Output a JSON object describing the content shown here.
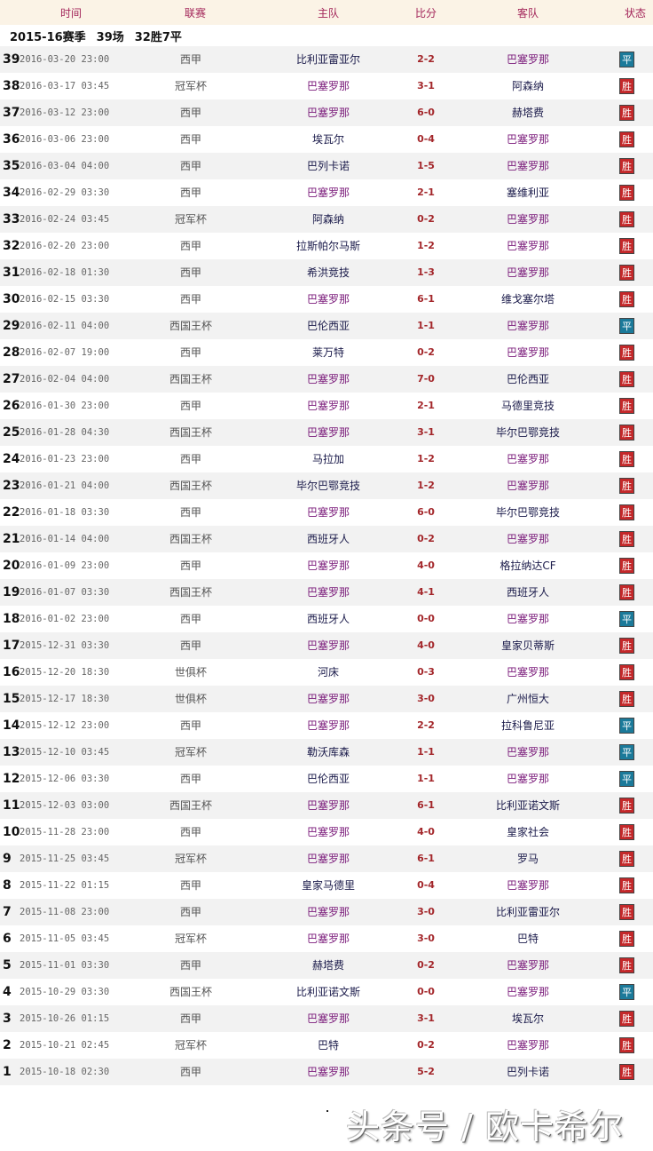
{
  "header": {
    "time": "时间",
    "league": "联赛",
    "home": "主队",
    "score": "比分",
    "away": "客队",
    "status": "状态"
  },
  "season": {
    "name": "2015-16赛季",
    "matches": "39场",
    "record": "32胜7平"
  },
  "highlight_team": "巴塞罗那",
  "status_colors": {
    "胜": "#c4282a",
    "平": "#1b7a9a"
  },
  "rows": [
    [
      "39",
      "2016-03-20 23:00",
      "西甲",
      "比利亚雷亚尔",
      "2-2",
      "巴塞罗那",
      "平"
    ],
    [
      "38",
      "2016-03-17 03:45",
      "冠军杯",
      "巴塞罗那",
      "3-1",
      "阿森纳",
      "胜"
    ],
    [
      "37",
      "2016-03-12 23:00",
      "西甲",
      "巴塞罗那",
      "6-0",
      "赫塔费",
      "胜"
    ],
    [
      "36",
      "2016-03-06 23:00",
      "西甲",
      "埃瓦尔",
      "0-4",
      "巴塞罗那",
      "胜"
    ],
    [
      "35",
      "2016-03-04 04:00",
      "西甲",
      "巴列卡诺",
      "1-5",
      "巴塞罗那",
      "胜"
    ],
    [
      "34",
      "2016-02-29 03:30",
      "西甲",
      "巴塞罗那",
      "2-1",
      "塞维利亚",
      "胜"
    ],
    [
      "33",
      "2016-02-24 03:45",
      "冠军杯",
      "阿森纳",
      "0-2",
      "巴塞罗那",
      "胜"
    ],
    [
      "32",
      "2016-02-20 23:00",
      "西甲",
      "拉斯帕尔马斯",
      "1-2",
      "巴塞罗那",
      "胜"
    ],
    [
      "31",
      "2016-02-18 01:30",
      "西甲",
      "希洪竞技",
      "1-3",
      "巴塞罗那",
      "胜"
    ],
    [
      "30",
      "2016-02-15 03:30",
      "西甲",
      "巴塞罗那",
      "6-1",
      "维戈塞尔塔",
      "胜"
    ],
    [
      "29",
      "2016-02-11 04:00",
      "西国王杯",
      "巴伦西亚",
      "1-1",
      "巴塞罗那",
      "平"
    ],
    [
      "28",
      "2016-02-07 19:00",
      "西甲",
      "莱万特",
      "0-2",
      "巴塞罗那",
      "胜"
    ],
    [
      "27",
      "2016-02-04 04:00",
      "西国王杯",
      "巴塞罗那",
      "7-0",
      "巴伦西亚",
      "胜"
    ],
    [
      "26",
      "2016-01-30 23:00",
      "西甲",
      "巴塞罗那",
      "2-1",
      "马德里竞技",
      "胜"
    ],
    [
      "25",
      "2016-01-28 04:30",
      "西国王杯",
      "巴塞罗那",
      "3-1",
      "毕尔巴鄂竞技",
      "胜"
    ],
    [
      "24",
      "2016-01-23 23:00",
      "西甲",
      "马拉加",
      "1-2",
      "巴塞罗那",
      "胜"
    ],
    [
      "23",
      "2016-01-21 04:00",
      "西国王杯",
      "毕尔巴鄂竞技",
      "1-2",
      "巴塞罗那",
      "胜"
    ],
    [
      "22",
      "2016-01-18 03:30",
      "西甲",
      "巴塞罗那",
      "6-0",
      "毕尔巴鄂竞技",
      "胜"
    ],
    [
      "21",
      "2016-01-14 04:00",
      "西国王杯",
      "西班牙人",
      "0-2",
      "巴塞罗那",
      "胜"
    ],
    [
      "20",
      "2016-01-09 23:00",
      "西甲",
      "巴塞罗那",
      "4-0",
      "格拉纳达CF",
      "胜"
    ],
    [
      "19",
      "2016-01-07 03:30",
      "西国王杯",
      "巴塞罗那",
      "4-1",
      "西班牙人",
      "胜"
    ],
    [
      "18",
      "2016-01-02 23:00",
      "西甲",
      "西班牙人",
      "0-0",
      "巴塞罗那",
      "平"
    ],
    [
      "17",
      "2015-12-31 03:30",
      "西甲",
      "巴塞罗那",
      "4-0",
      "皇家贝蒂斯",
      "胜"
    ],
    [
      "16",
      "2015-12-20 18:30",
      "世俱杯",
      "河床",
      "0-3",
      "巴塞罗那",
      "胜"
    ],
    [
      "15",
      "2015-12-17 18:30",
      "世俱杯",
      "巴塞罗那",
      "3-0",
      "广州恒大",
      "胜"
    ],
    [
      "14",
      "2015-12-12 23:00",
      "西甲",
      "巴塞罗那",
      "2-2",
      "拉科鲁尼亚",
      "平"
    ],
    [
      "13",
      "2015-12-10 03:45",
      "冠军杯",
      "勒沃库森",
      "1-1",
      "巴塞罗那",
      "平"
    ],
    [
      "12",
      "2015-12-06 03:30",
      "西甲",
      "巴伦西亚",
      "1-1",
      "巴塞罗那",
      "平"
    ],
    [
      "11",
      "2015-12-03 03:00",
      "西国王杯",
      "巴塞罗那",
      "6-1",
      "比利亚诺文斯",
      "胜"
    ],
    [
      "10",
      "2015-11-28 23:00",
      "西甲",
      "巴塞罗那",
      "4-0",
      "皇家社会",
      "胜"
    ],
    [
      "9",
      "2015-11-25 03:45",
      "冠军杯",
      "巴塞罗那",
      "6-1",
      "罗马",
      "胜"
    ],
    [
      "8",
      "2015-11-22 01:15",
      "西甲",
      "皇家马德里",
      "0-4",
      "巴塞罗那",
      "胜"
    ],
    [
      "7",
      "2015-11-08 23:00",
      "西甲",
      "巴塞罗那",
      "3-0",
      "比利亚雷亚尔",
      "胜"
    ],
    [
      "6",
      "2015-11-05 03:45",
      "冠军杯",
      "巴塞罗那",
      "3-0",
      "巴特",
      "胜"
    ],
    [
      "5",
      "2015-11-01 03:30",
      "西甲",
      "赫塔费",
      "0-2",
      "巴塞罗那",
      "胜"
    ],
    [
      "4",
      "2015-10-29 03:30",
      "西国王杯",
      "比利亚诺文斯",
      "0-0",
      "巴塞罗那",
      "平"
    ],
    [
      "3",
      "2015-10-26 01:15",
      "西甲",
      "巴塞罗那",
      "3-1",
      "埃瓦尔",
      "胜"
    ],
    [
      "2",
      "2015-10-21 02:45",
      "冠军杯",
      "巴特",
      "0-2",
      "巴塞罗那",
      "胜"
    ],
    [
      "1",
      "2015-10-18 02:30",
      "西甲",
      "巴塞罗那",
      "5-2",
      "巴列卡诺",
      "胜"
    ]
  ],
  "watermark": "头条号 / 欧卡希尔"
}
